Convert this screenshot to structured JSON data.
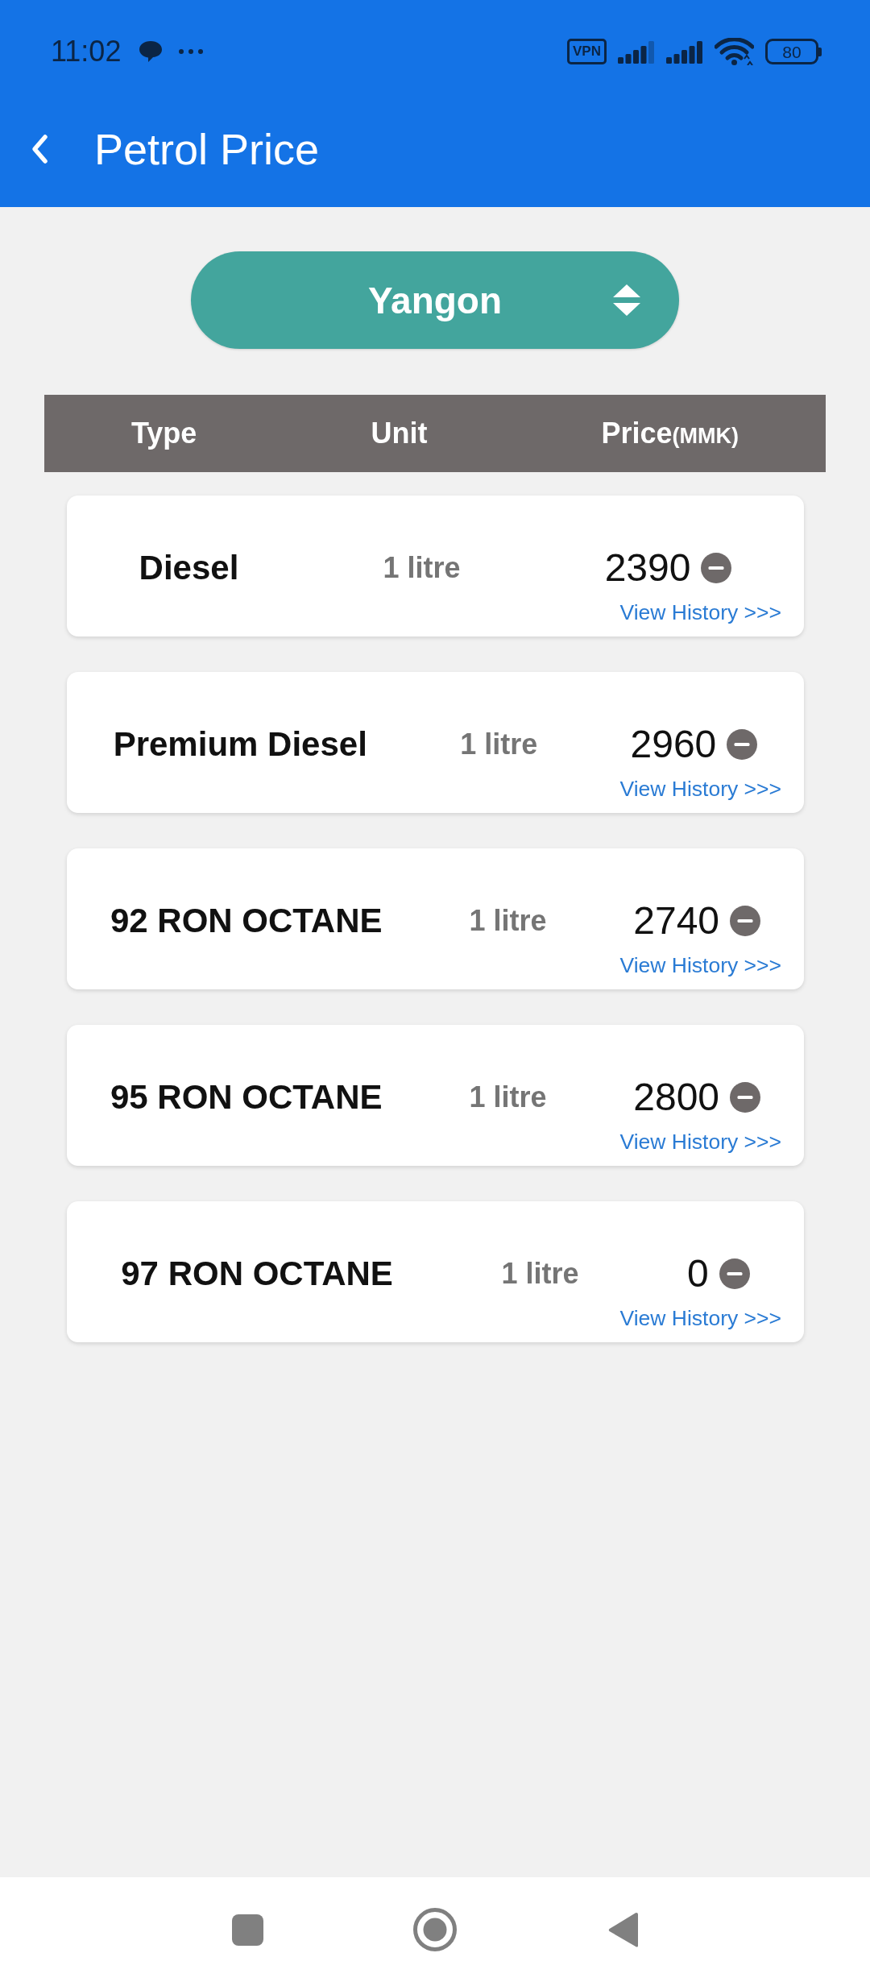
{
  "status_bar": {
    "time": "11:02",
    "vpn": "VPN",
    "battery": "80"
  },
  "app_bar": {
    "title": "Petrol Price"
  },
  "region_dropdown": {
    "value": "Yangon"
  },
  "table": {
    "columns": [
      {
        "label": "Type"
      },
      {
        "label": "Unit"
      },
      {
        "label": "Price",
        "unit": "(MMK)"
      }
    ],
    "rows": [
      {
        "type": "Diesel",
        "unit": "1 litre",
        "price": "2390",
        "link": "View History >>>"
      },
      {
        "type": "Premium Diesel",
        "unit": "1 litre",
        "price": "2960",
        "link": "View History >>>"
      },
      {
        "type": "92 RON OCTANE",
        "unit": "1 litre",
        "price": "2740",
        "link": "View History >>>"
      },
      {
        "type": "95 RON OCTANE",
        "unit": "1 litre",
        "price": "2800",
        "link": "View History >>>"
      },
      {
        "type": "97 RON OCTANE",
        "unit": "1 litre",
        "price": "0",
        "link": "View History >>>"
      }
    ]
  }
}
